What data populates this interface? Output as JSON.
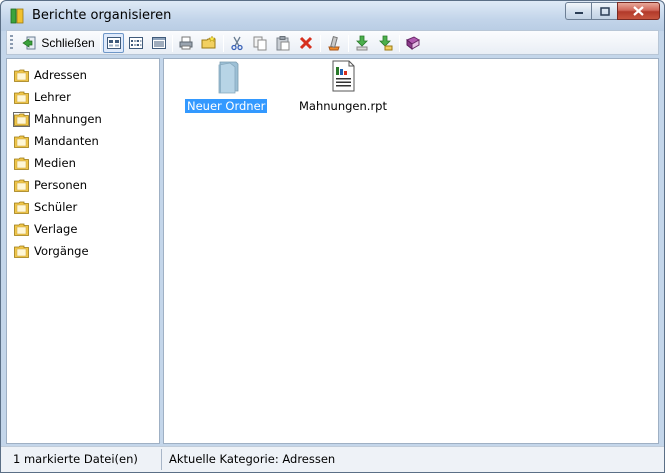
{
  "window": {
    "title": "Berichte organisieren"
  },
  "toolbar": {
    "close_label": "Schließen",
    "buttons": [
      "close-report-icon",
      "view-large-icons",
      "view-list-icons",
      "view-details-icons",
      "printer-icon",
      "new-folder-icon",
      "cut-icon",
      "copy-icon",
      "paste-icon",
      "delete-icon",
      "rename-icon",
      "import-icon",
      "export-icon",
      "help-book-icon"
    ]
  },
  "sidebar": {
    "items": [
      {
        "label": "Adressen"
      },
      {
        "label": "Lehrer"
      },
      {
        "label": "Mahnungen"
      },
      {
        "label": "Mandanten"
      },
      {
        "label": "Medien"
      },
      {
        "label": "Personen"
      },
      {
        "label": "Schüler"
      },
      {
        "label": "Verlage"
      },
      {
        "label": "Vorgänge"
      }
    ],
    "selected": "Mahnungen"
  },
  "files": {
    "items": [
      {
        "label": "Neuer Ordner",
        "icon": "folder-icon",
        "selected": true
      },
      {
        "label": "Mahnungen.rpt",
        "icon": "report-file-icon",
        "selected": false
      }
    ]
  },
  "status": {
    "left": "1 markierte Datei(en)",
    "right": "Aktuelle Kategorie: Adressen"
  },
  "colors": {
    "selection": "#3399ff",
    "chrome": "#c4d6ea",
    "close_button": "#c8553f"
  }
}
